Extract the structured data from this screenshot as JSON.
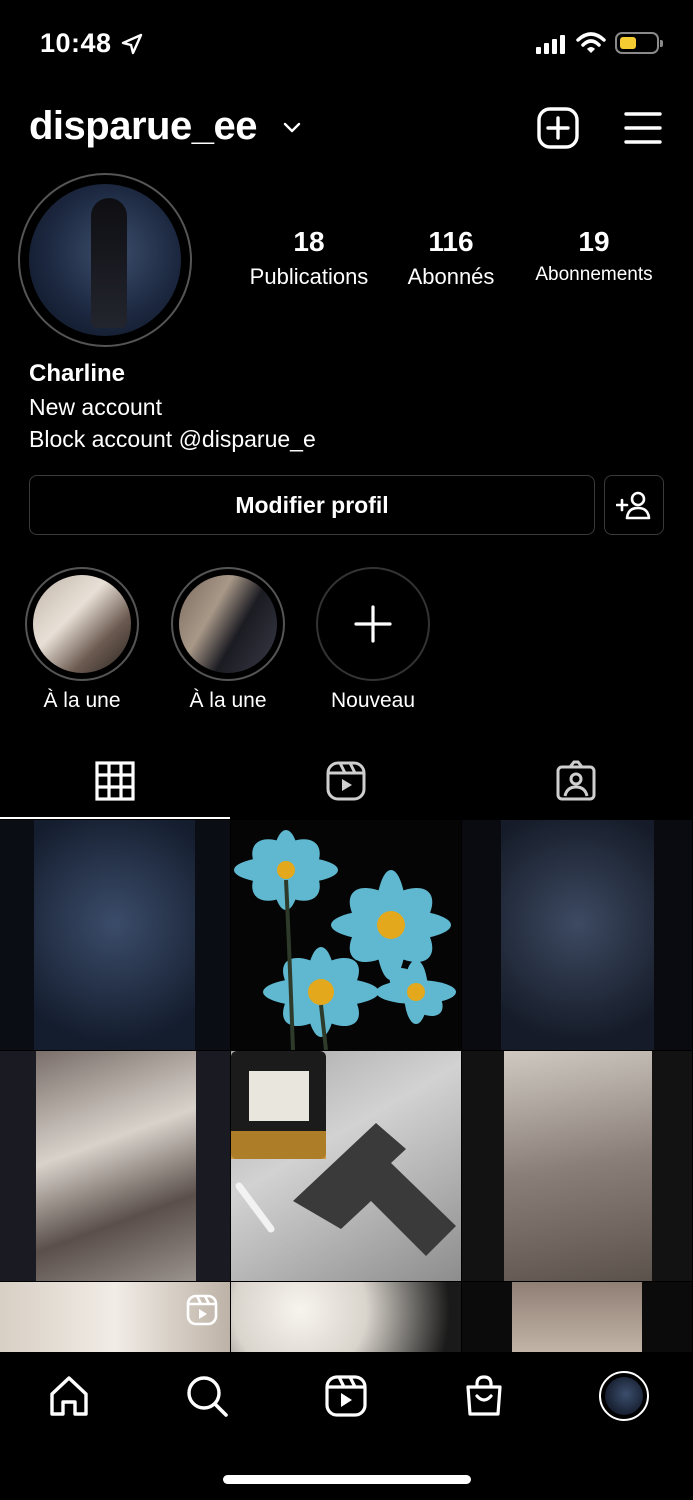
{
  "status_bar": {
    "time": "10:48"
  },
  "header": {
    "username": "disparue_ee"
  },
  "profile": {
    "stats": [
      {
        "value": "18",
        "label": "Publications"
      },
      {
        "value": "116",
        "label": "Abonnés"
      },
      {
        "value": "19",
        "label": "Abonnements"
      }
    ],
    "name": "Charline",
    "bio_lines": [
      "New account",
      "Block account @disparue_e"
    ],
    "edit_label": "Modifier profil"
  },
  "highlights": [
    {
      "label": "À la une"
    },
    {
      "label": "À la une"
    },
    {
      "label": "Nouveau"
    }
  ],
  "tabs": [
    "grid-icon",
    "reels-icon",
    "tagged-icon"
  ],
  "colors": {
    "background": "#000000",
    "battery": "#f5cc32",
    "flower": "#5fb8d0"
  }
}
